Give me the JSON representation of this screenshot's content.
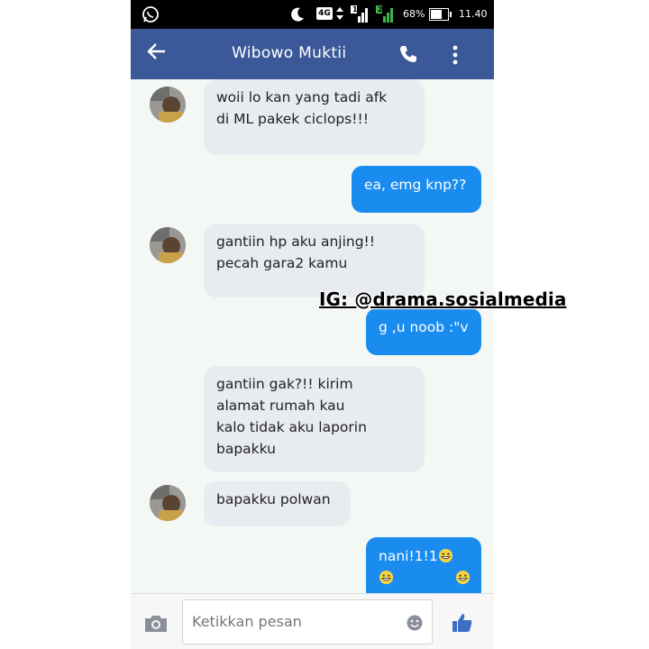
{
  "status_bar": {
    "network": "4G",
    "sim1": "1",
    "sim2": "2",
    "battery": "68%",
    "battery_level": 0.68,
    "time": "11.40",
    "icons": [
      "whatsapp-icon",
      "moon-icon",
      "signal-icon",
      "battery-icon"
    ]
  },
  "header": {
    "title": "Wibowo Muktii",
    "icons": [
      "back-arrow-icon",
      "phone-icon",
      "more-vertical-icon"
    ]
  },
  "messages": [
    {
      "side": "in",
      "lines": [
        "woii lo kan yang tadi afk",
        "di ML pakek ciclops!!!"
      ]
    },
    {
      "side": "out",
      "lines": [
        "ea, emg knp??"
      ]
    },
    {
      "side": "in",
      "lines": [
        "gantiin hp aku anjing!!",
        "pecah gara2 kamu"
      ]
    },
    {
      "side": "out",
      "lines": [
        "g ,u noob :\"v"
      ]
    },
    {
      "side": "in",
      "lines": [
        "gantiin gak?!! kirim",
        "alamat rumah kau",
        "kalo tidak aku laporin",
        "bapakku"
      ]
    },
    {
      "side": "in",
      "lines": [
        "bapakku polwan"
      ]
    },
    {
      "side": "out",
      "lines": [
        "nani!1!1"
      ],
      "emojis": [
        "grinning-emoji-icon",
        "grinning-emoji-icon",
        "grinning-emoji-icon"
      ]
    }
  ],
  "watermark": "IG: @drama.sosialmedia",
  "composer": {
    "placeholder": "Ketikkan pesan",
    "icons": [
      "camera-icon",
      "emoji-icon",
      "thumbs-up-icon"
    ]
  },
  "colors": {
    "header": "#3b5998",
    "outgoing_bubble": "#1a8cf0",
    "incoming_bubble": "#e8ebef"
  }
}
